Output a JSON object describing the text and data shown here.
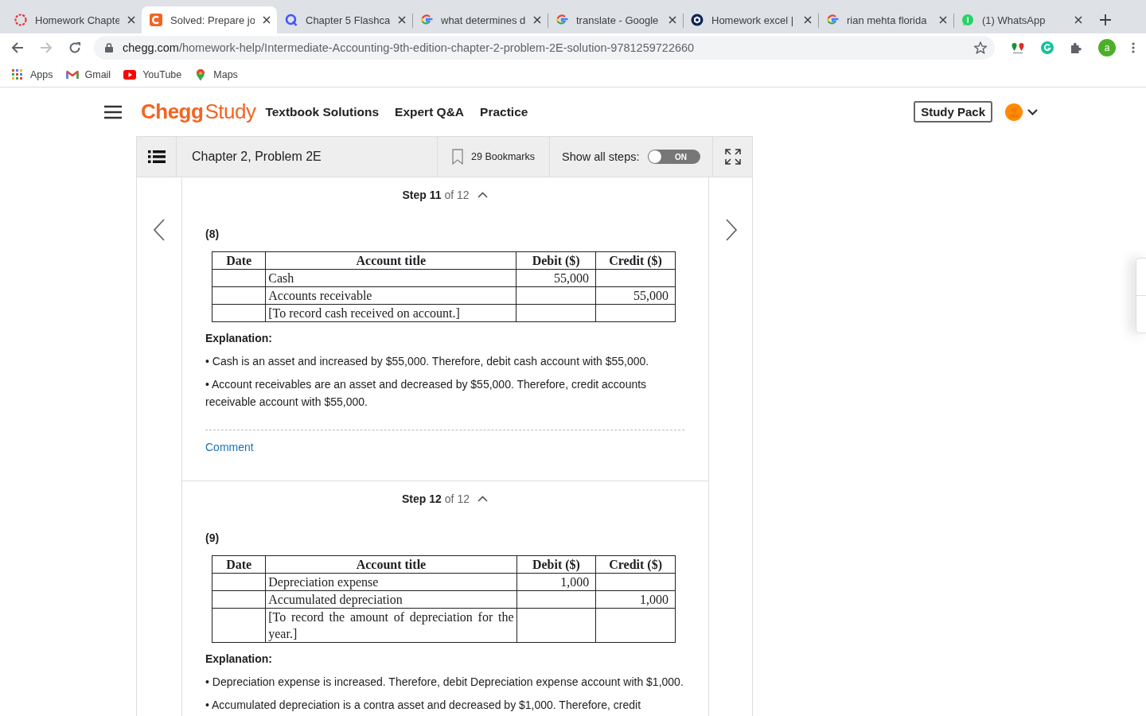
{
  "browser": {
    "tabs": [
      {
        "title": "Homework Chapte",
        "kind": "ring",
        "selected": false
      },
      {
        "title": "Solved: Prepare jo",
        "kind": "chegg",
        "selected": true
      },
      {
        "title": "Chapter 5 Flashca",
        "kind": "quiz",
        "selected": false
      },
      {
        "title": "what determines d",
        "kind": "google",
        "selected": false
      },
      {
        "title": "translate - Google",
        "kind": "google",
        "selected": false
      },
      {
        "title": "Homework excel |",
        "kind": "hero",
        "selected": false
      },
      {
        "title": "rian mehta florida",
        "kind": "google",
        "selected": false
      },
      {
        "title": "(1) WhatsApp",
        "kind": "chat",
        "selected": false
      }
    ],
    "url_domain": "chegg.com",
    "url_path": "/homework-help/Intermediate-Accounting-9th-edition-chapter-2-problem-2E-solution-9781259722660",
    "profile_letter": "a",
    "bookmarks": [
      {
        "label": "Apps",
        "kind": "apps"
      },
      {
        "label": "Gmail",
        "kind": "mail"
      },
      {
        "label": "YouTube",
        "kind": "video"
      },
      {
        "label": "Maps",
        "kind": "pin"
      }
    ]
  },
  "header": {
    "brand": "Chegg",
    "product": "Study",
    "nav": [
      "Textbook Solutions",
      "Expert Q&A",
      "Practice"
    ],
    "study_pack": "Study Pack"
  },
  "toolbar": {
    "title": "Chapter 2, Problem 2E",
    "bookmarks": "29 Bookmarks",
    "show_all_label": "Show all steps:",
    "toggle_label": "ON",
    "toggle_on": false
  },
  "steps": [
    {
      "step": "Step 11",
      "of": "of 12",
      "part": "(8)",
      "columns": [
        "Date",
        "Account title",
        "Debit ($)",
        "Credit ($)"
      ],
      "rows": [
        [
          "",
          "Cash",
          "55,000",
          ""
        ],
        [
          "",
          "Accounts receivable",
          "",
          "55,000"
        ],
        [
          "",
          "[To record cash received on account.]",
          "",
          ""
        ]
      ],
      "explanation_title": "Explanation:",
      "bullets": [
        "• Cash is an asset and increased by $55,000. Therefore, debit cash account with $55,000.",
        "• Account receivables are an asset and decreased by $55,000. Therefore, credit accounts receivable account with $55,000."
      ],
      "comment": "Comment"
    },
    {
      "step": "Step 12",
      "of": "of 12",
      "part": "(9)",
      "columns": [
        "Date",
        "Account title",
        "Debit ($)",
        "Credit ($)"
      ],
      "rows": [
        [
          "",
          "Depreciation expense",
          "1,000",
          ""
        ],
        [
          "",
          "Accumulated depreciation",
          "",
          "1,000"
        ],
        [
          "",
          "[To record the amount of depreciation for the year.]",
          "",
          ""
        ]
      ],
      "explanation_title": "Explanation:",
      "bullets": [
        "• Depreciation expense is increased. Therefore, debit Depreciation expense account with $1,000.",
        "• Accumulated depreciation is a contra asset and decreased by $1,000. Therefore, credit"
      ]
    }
  ]
}
